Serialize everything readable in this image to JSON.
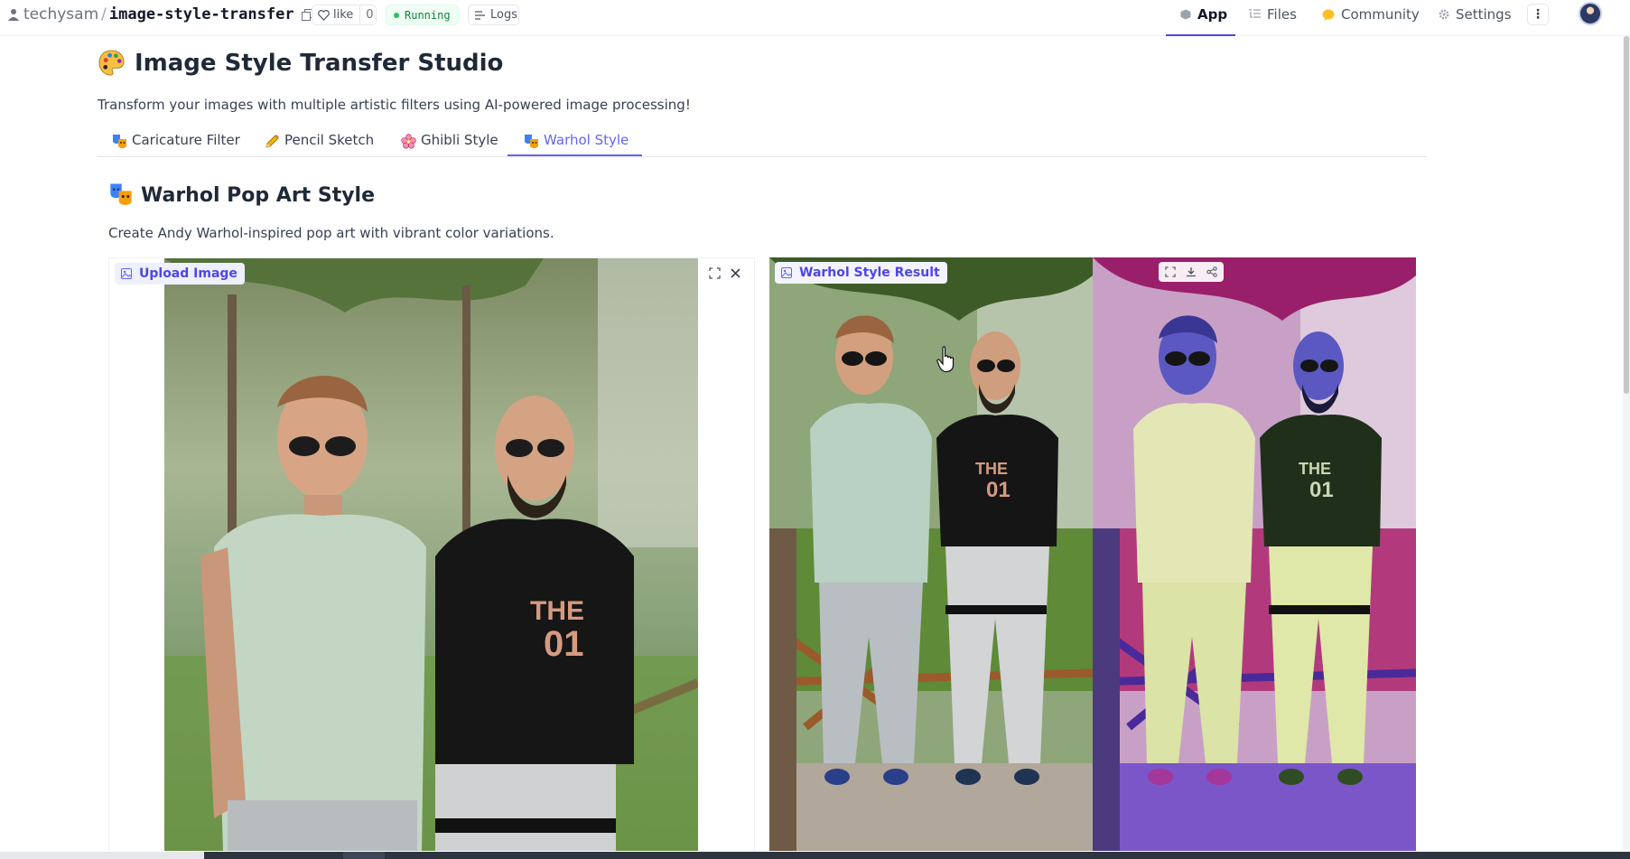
{
  "header": {
    "owner": "techysam",
    "separator": "/",
    "repo_name": "image-style-transfer",
    "like_label": "like",
    "like_count": "0",
    "status_label": "Running",
    "logs_label": "Logs",
    "nav": {
      "app": "App",
      "files": "Files",
      "community": "Community",
      "settings": "Settings"
    },
    "more_label": "⋮"
  },
  "page": {
    "title": "Image Style Transfer Studio",
    "subtitle": "Transform your images with multiple artistic filters using AI-powered image processing!",
    "tabs": [
      {
        "label": "Caricature Filter",
        "icon": "theater-masks-icon",
        "selected": false
      },
      {
        "label": "Pencil Sketch",
        "icon": "pencil-icon",
        "selected": false
      },
      {
        "label": "Ghibli Style",
        "icon": "cherry-blossom-icon",
        "selected": false
      },
      {
        "label": "Warhol Style",
        "icon": "theater-masks-icon",
        "selected": true
      }
    ]
  },
  "section": {
    "title": "Warhol Pop Art Style",
    "description": "Create Andy Warhol-inspired pop art with vibrant color variations.",
    "input_label": "Upload Image",
    "output_label": "Warhol Style Result"
  },
  "colors": {
    "accent": "#6366f1",
    "running_green": "#22c55e",
    "badge_bg": "#eef0ff"
  }
}
